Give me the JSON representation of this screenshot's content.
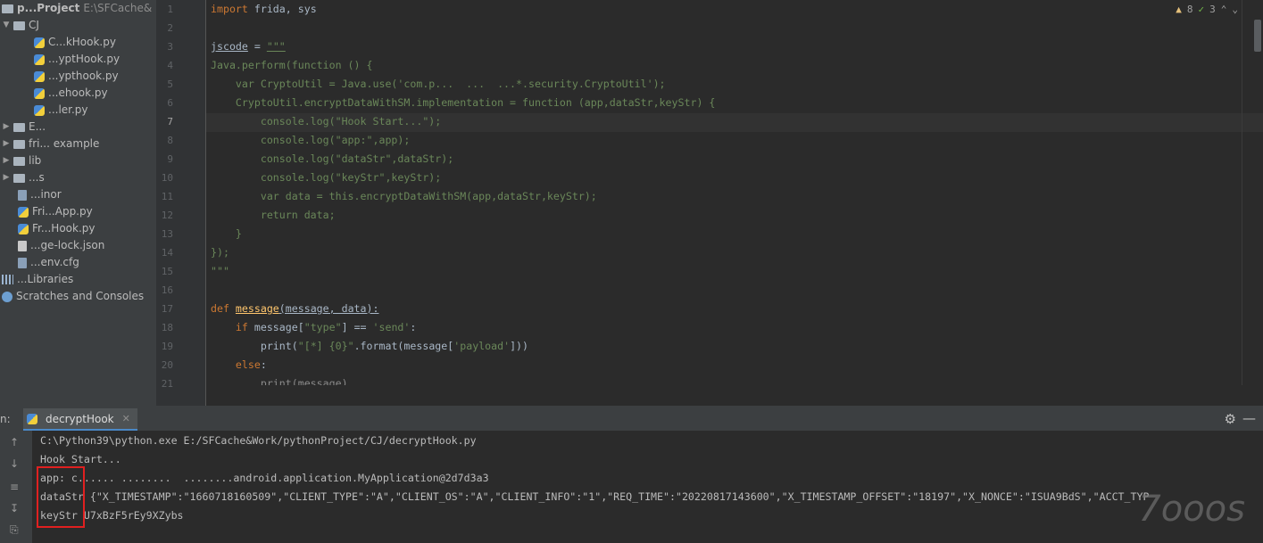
{
  "project_tree": {
    "root": {
      "label": "p...Project",
      "path": "E:\\SFCache&"
    },
    "cj_folder": "CJ",
    "cj_files": [
      "C...kHook.py",
      "...yptHook.py",
      "...ypthook.py",
      "...ehook.py",
      "...ler.py"
    ],
    "collapsed": [
      "E...",
      "fri... example",
      "lib",
      "...s"
    ],
    "items": [
      "...inor",
      "Fri...App.py",
      "Fr...Hook.py",
      "...ge-lock.json",
      "...env.cfg"
    ],
    "libraries": "...Libraries",
    "scratches": "Scratches and Consoles"
  },
  "editor": {
    "line_numbers": [
      "1",
      "2",
      "3",
      "4",
      "5",
      "6",
      "7",
      "8",
      "9",
      "10",
      "11",
      "12",
      "13",
      "14",
      "15",
      "16",
      "17",
      "18",
      "19",
      "20",
      "21"
    ],
    "lines": {
      "l1_kw": "import",
      "l1_rest": " frida, sys",
      "l3_name": "jscode",
      "l3_rest": " = ",
      "l3_str": "\"\"\"",
      "l4": "Java.perform(function () {",
      "l5": "    var CryptoUtil = Java.use('com.p...  ...  ...*.security.CryptoUtil');",
      "l6": "    CryptoUtil.encryptDataWithSM.implementation = function (app,dataStr,keyStr) {",
      "l7": "        console.log(\"Hook Start...\");",
      "l8": "        console.log(\"app:\",app);",
      "l9": "        console.log(\"dataStr\",dataStr);",
      "l10": "        console.log(\"keyStr\",keyStr);",
      "l11": "        var data = this.encryptDataWithSM(app,dataStr,keyStr);",
      "l12": "        return data;",
      "l13": "    }",
      "l14": "});",
      "l15": "\"\"\"",
      "l17_kw": "def ",
      "l17_fn": "message",
      "l17_args": "(message, data):",
      "l18_kw": "    if",
      "l18_mid": " message[",
      "l18_s1": "\"type\"",
      "l18_eq": "] == ",
      "l18_s2": "'send'",
      "l18_end": ":",
      "l19_a": "        print(",
      "l19_s": "\"[*] {0}\"",
      "l19_b": ".format(message[",
      "l19_s2": "'payload'",
      "l19_c": "]))",
      "l20_kw": "    else",
      "l20_end": ":",
      "l21": "        print(message)"
    },
    "inspections": {
      "warnings": "8",
      "ok": "3"
    }
  },
  "run": {
    "label": "n:",
    "tab": "decryptHook",
    "console": [
      "C:\\Python39\\python.exe E:/SFCache&Work/pythonProject/CJ/decryptHook.py",
      "Hook Start...",
      "app: c...... ........  ........android.application.MyApplication@2d7d3a3",
      "dataStr {\"X_TIMESTAMP\":\"1660718160509\",\"CLIENT_TYPE\":\"A\",\"CLIENT_OS\":\"A\",\"CLIENT_INFO\":\"1\",\"REQ_TIME\":\"20220817143600\",\"X_TIMESTAMP_OFFSET\":\"18197\",\"X_NONCE\":\"ISUA9BdS\",\"ACCT_TYP",
      "keyStr U7xBzF5rEy9XZybs"
    ]
  },
  "watermark": "7ooos"
}
